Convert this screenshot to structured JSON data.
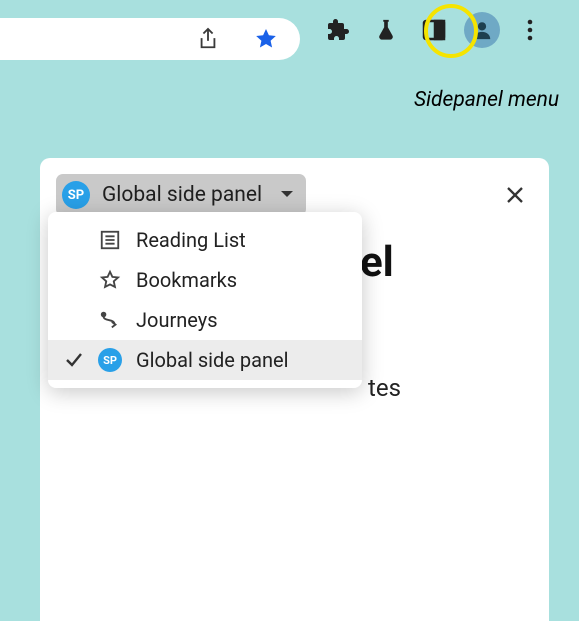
{
  "annotation": "Sidepanel menu",
  "toolbar": {
    "share_icon": "share-icon",
    "star_icon": "bookmark-star-icon",
    "extensions_icon": "extensions-icon",
    "labs_icon": "labs-icon",
    "sidepanel_icon": "sidepanel-icon",
    "profile_icon": "profile-icon",
    "menu_icon": "kebab-menu-icon"
  },
  "sidepanel": {
    "selector": {
      "badge": "SP",
      "label": "Global side panel"
    },
    "close_label": "Close",
    "dropdown": {
      "items": [
        {
          "label": "Reading List",
          "icon": "reading-list-icon",
          "selected": false
        },
        {
          "label": "Bookmarks",
          "icon": "star-outline-icon",
          "selected": false
        },
        {
          "label": "Journeys",
          "icon": "journeys-icon",
          "selected": false
        },
        {
          "label": "Global side panel",
          "icon": "sp-badge-icon",
          "selected": true
        }
      ]
    },
    "behind_fragment_1": "el",
    "behind_fragment_2": "tes"
  }
}
